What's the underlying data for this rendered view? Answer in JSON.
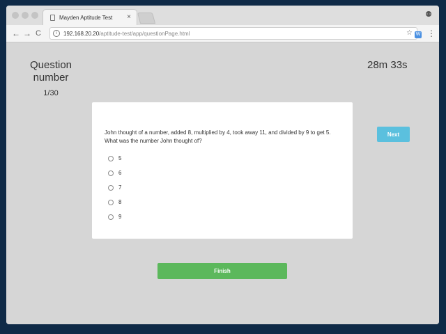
{
  "browser": {
    "tab_title": "Mayden Aptitude Test",
    "tab_close": "×",
    "url_host": "192.168.20.20",
    "url_path": "/aptitude-test/app/questionPage.html",
    "nav_back": "←",
    "nav_forward": "→",
    "nav_reload": "C",
    "info_glyph": "i",
    "star_glyph": "☆",
    "ext_glyph": "W",
    "menu_glyph": "⋮",
    "profile_glyph": "⚉"
  },
  "quiz": {
    "question_number_label": "Question number",
    "question_count": "1/30",
    "timer": "28m 33s",
    "question_text": "John thought of a number, added 8, multiplied by 4, took away 11, and divided by 9 to get 5. What was the number John thought of?",
    "options": [
      {
        "label": "5"
      },
      {
        "label": "6"
      },
      {
        "label": "7"
      },
      {
        "label": "8"
      },
      {
        "label": "9"
      }
    ],
    "next_label": "Next",
    "finish_label": "Finish"
  },
  "colors": {
    "next_button": "#5bc0de",
    "finish_button": "#5cb85c",
    "page_background": "#d6d6d6"
  }
}
